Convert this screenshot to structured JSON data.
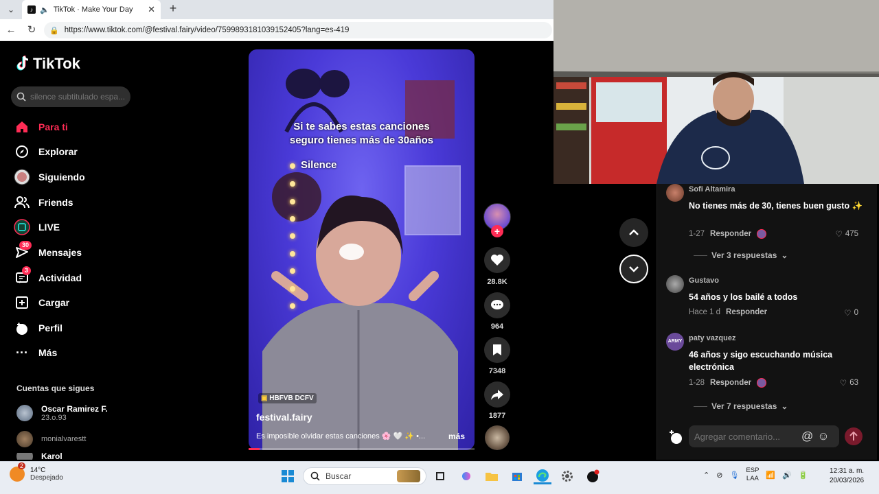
{
  "browser": {
    "tab_title": "TikTok · Make Your Day",
    "url": "https://www.tiktok.com/@festival.fairy/video/7599893181039152405?lang=es-419"
  },
  "sidebar": {
    "logo": "TikTok",
    "search_placeholder": "silence subtitulado espa...",
    "items": [
      {
        "label": "Para ti",
        "active": true
      },
      {
        "label": "Explorar"
      },
      {
        "label": "Siguiendo"
      },
      {
        "label": "Friends"
      },
      {
        "label": "LIVE"
      },
      {
        "label": "Mensajes",
        "badge": "30"
      },
      {
        "label": "Actividad",
        "badge": "3"
      },
      {
        "label": "Cargar"
      },
      {
        "label": "Perfil"
      },
      {
        "label": "Más"
      }
    ],
    "following_title": "Cuentas que sigues",
    "following": [
      {
        "name": "Oscar Ramirez F.",
        "sub": "23.o.93"
      },
      {
        "name": "",
        "sub": "monialvarestt"
      },
      {
        "name": "Karol",
        "sub": ""
      }
    ]
  },
  "video": {
    "caption_line1": "Si te sabes estas canciones",
    "caption_line2": "seguro tienes más de 30años",
    "song_label": "Silence",
    "tag": "HBFVB DCFV",
    "username": "festival.fairy",
    "description": "Es imposible olvidar estas canciones 🌸 🤍 ✨ •...",
    "more": "más",
    "progress": 0.05
  },
  "actions": {
    "likes": "28.8K",
    "comments": "964",
    "saves": "7348",
    "shares": "1877"
  },
  "comments": [
    {
      "user": "Sofi Altamira",
      "text": "No tienes más de 30, tienes buen gusto ✨",
      "date": "1-27",
      "reply": "Responder",
      "likes": "475",
      "creator_liked": true
    },
    {
      "views": "Ver 3 respuestas"
    },
    {
      "user": "Gustavo",
      "text": "54 años y los bailé a todos",
      "date": "Hace 1 d",
      "reply": "Responder",
      "likes": "0",
      "creator_liked": false
    },
    {
      "user": "paty vazquez",
      "text": "46 años y sigo escuchando música electrónica",
      "date": "1-28",
      "reply": "Responder",
      "likes": "63",
      "creator_liked": true
    },
    {
      "views": "Ver 7 respuestas"
    }
  ],
  "comment_input_placeholder": "Agregar comentario...",
  "taskbar": {
    "weather_temp": "14°C",
    "weather_desc": "Despejado",
    "weather_badge": "2",
    "search": "Buscar",
    "lang1": "ESP",
    "lang2": "LAA",
    "time": "12:31 a. m.",
    "date": "20/03/2026"
  },
  "colors": {
    "accent": "#fe2c55",
    "video_bg": "#4a3ad8"
  }
}
